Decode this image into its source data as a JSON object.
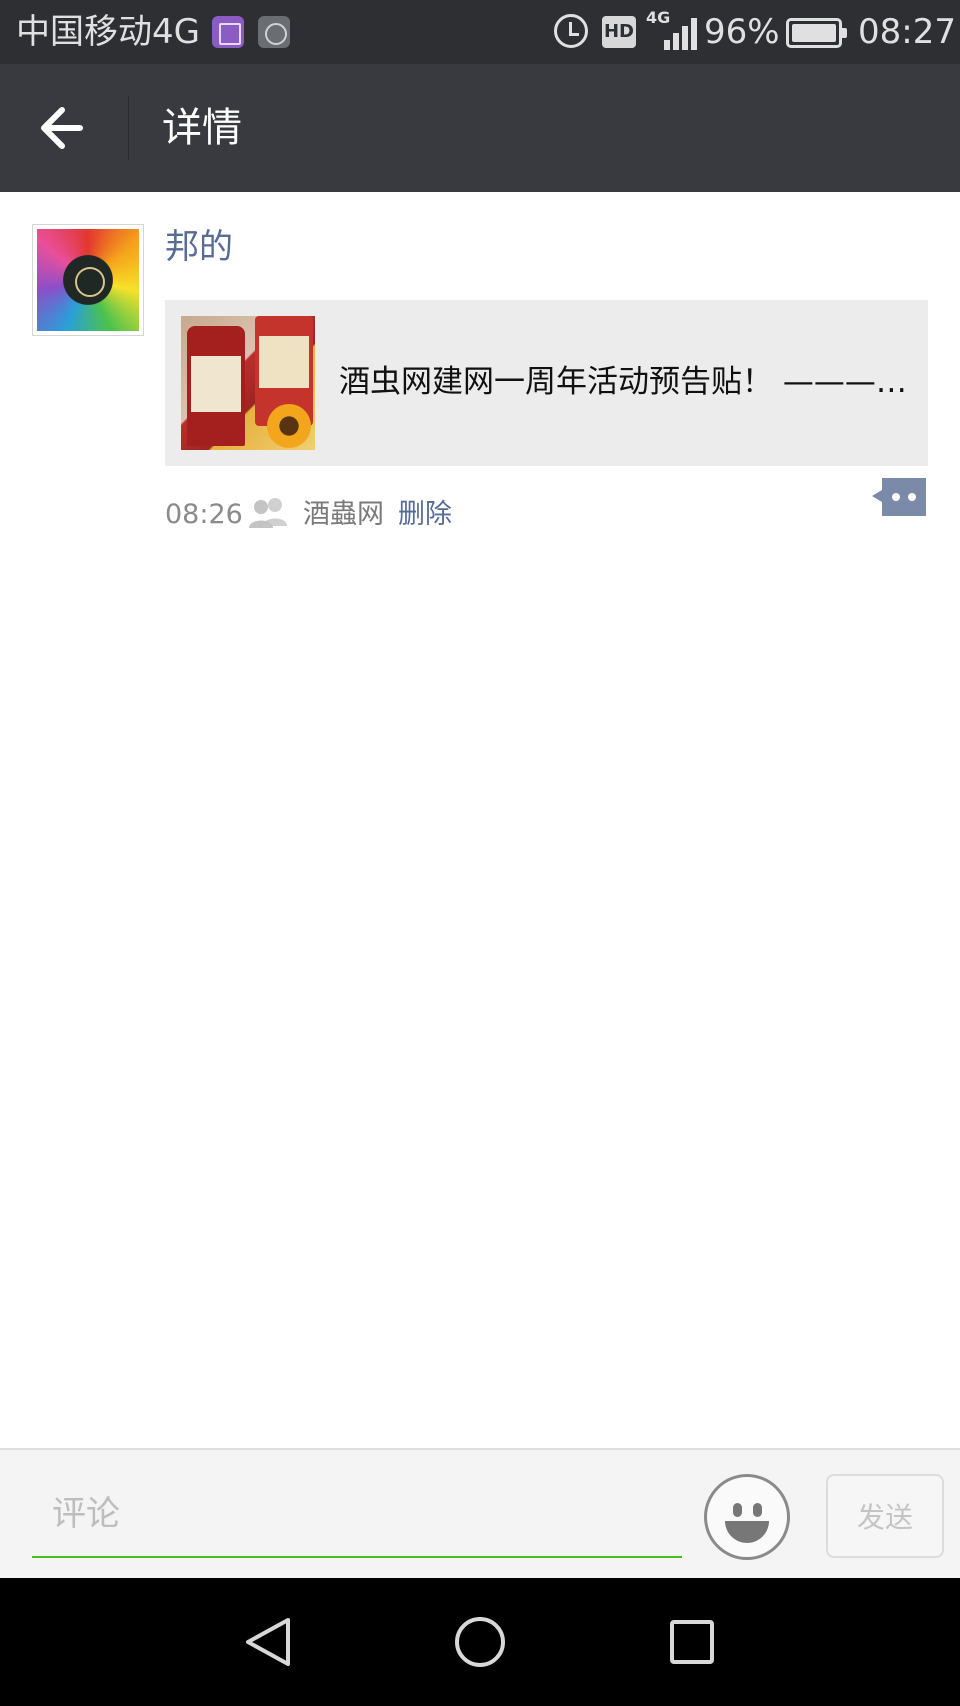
{
  "status_bar": {
    "carrier": "中国移动4G",
    "hd_label": "HD",
    "network_type": "4G",
    "battery_percent": "96%",
    "battery_level": 0.96,
    "time": "08:27",
    "icons": [
      "gallery-notification-icon",
      "clock-app-notification-icon",
      "alarm-icon",
      "hd-badge",
      "signal-icon",
      "battery-icon"
    ]
  },
  "header": {
    "title": "详情",
    "back_icon": "arrow-left-icon"
  },
  "post": {
    "author": "邦的",
    "link": {
      "title": "酒虫网建网一周年活动预告贴！ ————…"
    },
    "meta": {
      "time": "08:26",
      "visibility_icon": "group-icon",
      "source": "酒蟲网",
      "delete_label": "删除",
      "more_icon": "comment-more-icon"
    }
  },
  "comment_bar": {
    "placeholder": "评论",
    "value": "",
    "emoji_icon": "smiley-icon",
    "send_label": "发送"
  },
  "nav_bar": {
    "icons": [
      "back-triangle-icon",
      "home-circle-icon",
      "recents-square-icon"
    ]
  },
  "colors": {
    "status_bar_bg": "#2e2f33",
    "header_bg": "#393a3f",
    "link_blue": "#576b95",
    "input_underline": "#45c01a",
    "card_bg": "#ececec"
  }
}
